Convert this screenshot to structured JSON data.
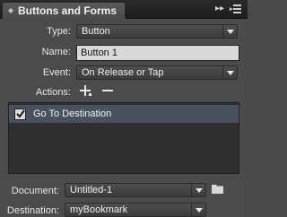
{
  "panel": {
    "title": "Buttons and Forms"
  },
  "form": {
    "type_label": "Type:",
    "type_value": "Button",
    "name_label": "Name:",
    "name_value": "Button 1",
    "event_label": "Event:",
    "event_value": "On Release or Tap",
    "actions_label": "Actions:"
  },
  "actions": {
    "items": [
      {
        "label": "Go To Destination",
        "checked": true
      }
    ]
  },
  "destination": {
    "document_label": "Document:",
    "document_value": "Untitled-1",
    "destination_label": "Destination:",
    "destination_value": "myBookmark"
  },
  "icons": {
    "panel_collapse": "double-chevron-right-icon",
    "panel_menu": "panel-menu-icon",
    "add_action": "plus-icon",
    "remove_action": "minus-icon",
    "browse_document": "folder-icon",
    "dropdown": "chevron-down-icon",
    "checkmark": "checkmark-icon"
  },
  "colors": {
    "panel_bg": "#4b4b4b",
    "selected_row": "#48525e",
    "list_bg": "#2f2f2f"
  }
}
